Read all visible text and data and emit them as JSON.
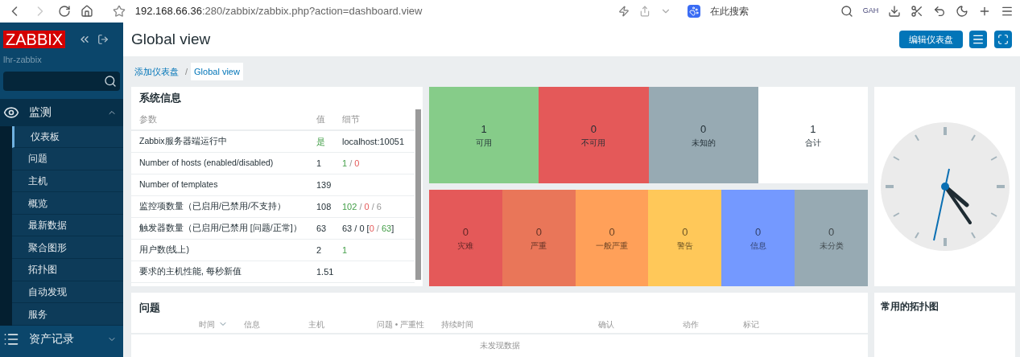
{
  "browser": {
    "url_host": "192.168.66.36",
    "url_rest": ":280/zabbix/zabbix.php?action=dashboard.view",
    "search_placeholder": "在此搜索",
    "extension_label": "GAH"
  },
  "sidebar": {
    "logo": "ZABBIX",
    "server_name": "lhr-zabbix",
    "sections": [
      {
        "label": "监测",
        "kind": "eye",
        "expanded": true,
        "items": [
          {
            "label": "仪表板",
            "selected": true
          },
          {
            "label": "问题",
            "selected": false
          },
          {
            "label": "主机",
            "selected": false
          },
          {
            "label": "概览",
            "selected": false
          },
          {
            "label": "最新数据",
            "selected": false
          },
          {
            "label": "聚合图形",
            "selected": false
          },
          {
            "label": "拓扑图",
            "selected": false
          },
          {
            "label": "自动发现",
            "selected": false
          },
          {
            "label": "服务",
            "selected": false
          }
        ]
      },
      {
        "label": "资产记录",
        "kind": "list",
        "expanded": false
      }
    ]
  },
  "header": {
    "title": "Global view",
    "edit_button": "编辑仪表盘"
  },
  "breadcrumb": {
    "separator": "/",
    "items": [
      {
        "label": "添加仪表盘",
        "selected": false
      },
      {
        "label": "Global view",
        "selected": true
      }
    ]
  },
  "system_info": {
    "title": "系统信息",
    "columns": [
      "参数",
      "值",
      "细节"
    ],
    "rows": [
      {
        "parameter": "Zabbix服务器端运行中",
        "value": {
          "text": "是",
          "kind": "ok"
        },
        "details": [
          {
            "text": "localhost:10051",
            "kind": "plain"
          }
        ]
      },
      {
        "parameter": "Number of hosts (enabled/disabled)",
        "value": {
          "text": "1",
          "kind": "plain"
        },
        "details": [
          {
            "text": "1",
            "kind": "ok"
          },
          {
            "text": " / ",
            "kind": "muted"
          },
          {
            "text": "0",
            "kind": "problem"
          }
        ]
      },
      {
        "parameter": "Number of templates",
        "value": {
          "text": "139",
          "kind": "plain"
        }
      },
      {
        "parameter": "监控项数量（已启用/已禁用/不支持）",
        "value": {
          "text": "108",
          "kind": "plain"
        },
        "details": [
          {
            "text": "102",
            "kind": "ok"
          },
          {
            "text": " / ",
            "kind": "muted"
          },
          {
            "text": "0",
            "kind": "problem"
          },
          {
            "text": " / ",
            "kind": "muted"
          },
          {
            "text": "6",
            "kind": "muted"
          }
        ]
      },
      {
        "parameter": "触发器数量（已启用/已禁用 [问题/正常]）",
        "value": {
          "text": "63",
          "kind": "plain"
        },
        "details": [
          {
            "text": "63 / 0 [",
            "kind": "plain"
          },
          {
            "text": "0",
            "kind": "problem"
          },
          {
            "text": " / ",
            "kind": "muted"
          },
          {
            "text": "63",
            "kind": "ok"
          },
          {
            "text": "]",
            "kind": "plain"
          }
        ]
      },
      {
        "parameter": "用户数(线上)",
        "value": {
          "text": "2",
          "kind": "plain"
        },
        "details": [
          {
            "text": "1",
            "kind": "ok"
          }
        ]
      },
      {
        "parameter": "要求的主机性能, 每秒新值",
        "value": {
          "text": "1.51",
          "kind": "plain"
        }
      }
    ]
  },
  "host_availability": [
    {
      "count": "1",
      "label": "可用",
      "color": "#86cc89"
    },
    {
      "count": "0",
      "label": "不可用",
      "color": "#e45959"
    },
    {
      "count": "0",
      "label": "未知的",
      "color": "#97aab3"
    },
    {
      "count": "1",
      "label": "合计",
      "color": "#ffffff"
    }
  ],
  "problems_by_severity": [
    {
      "count": "0",
      "label": "灾难",
      "color": "#e45959"
    },
    {
      "count": "0",
      "label": "严重",
      "color": "#e97659"
    },
    {
      "count": "0",
      "label": "一般严重",
      "color": "#ffa059"
    },
    {
      "count": "0",
      "label": "警告",
      "color": "#ffc859"
    },
    {
      "count": "0",
      "label": "信息",
      "color": "#7499ff"
    },
    {
      "count": "0",
      "label": "未分类",
      "color": "#97aab3"
    }
  ],
  "problems": {
    "title": "问题",
    "columns": [
      {
        "label": "时间",
        "sorted": true
      },
      {
        "label": "信息",
        "sorted": false
      },
      {
        "label": "主机",
        "sorted": false
      },
      {
        "label": "问题 • 严重性",
        "sorted": false
      },
      {
        "label": "持续时间",
        "sorted": false
      },
      {
        "label": "确认",
        "sorted": false
      },
      {
        "label": "动作",
        "sorted": false
      },
      {
        "label": "标记",
        "sorted": false
      }
    ],
    "empty_text": "未发现数据"
  },
  "topology": {
    "title": "常用的拓扑图"
  }
}
